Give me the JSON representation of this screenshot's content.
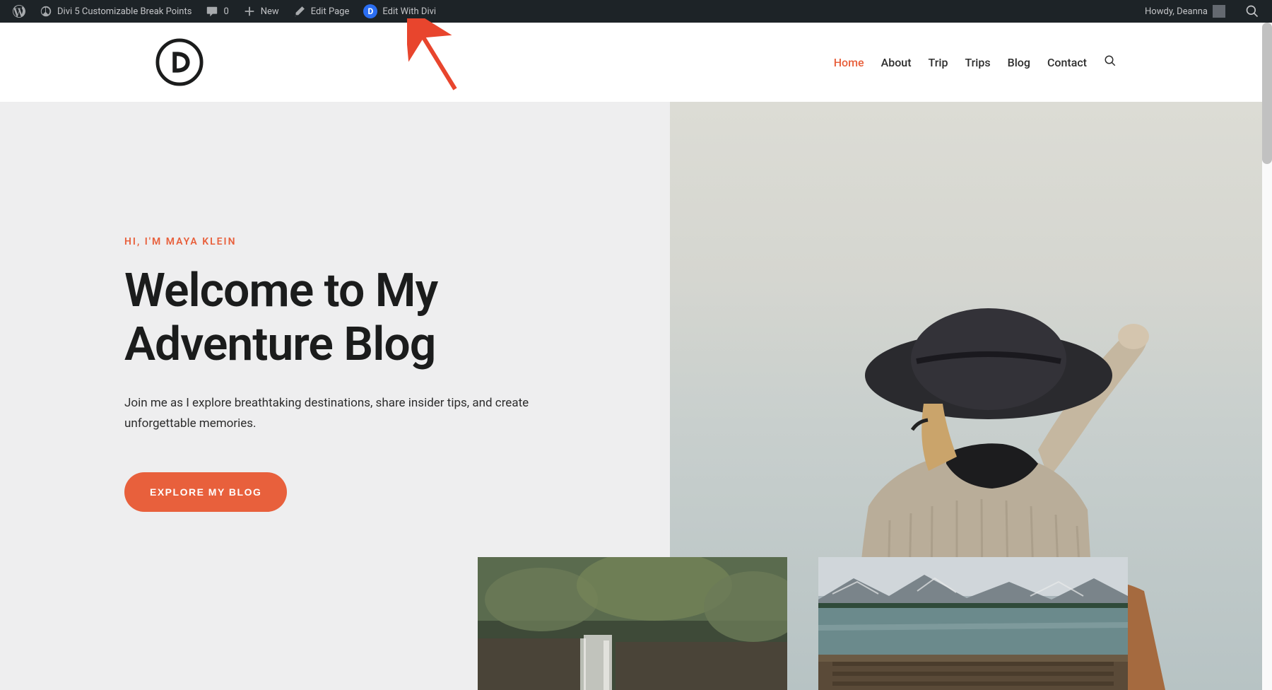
{
  "adminBar": {
    "siteName": "Divi 5 Customizable Break Points",
    "comments": "0",
    "newLabel": "New",
    "editPage": "Edit Page",
    "editWithDivi": "Edit With Divi",
    "greeting": "Howdy, Deanna"
  },
  "nav": {
    "items": [
      {
        "label": "Home",
        "active": true
      },
      {
        "label": "About",
        "active": false
      },
      {
        "label": "Trip",
        "active": false
      },
      {
        "label": "Trips",
        "active": false
      },
      {
        "label": "Blog",
        "active": false
      },
      {
        "label": "Contact",
        "active": false
      }
    ]
  },
  "hero": {
    "eyebrow": "HI, I'M MAYA KLEIN",
    "title": "Welcome to My Adventure Blog",
    "description": "Join me as I explore breathtaking destinations, share insider tips, and create unforgettable memories.",
    "buttonLabel": "EXPLORE MY BLOG"
  }
}
